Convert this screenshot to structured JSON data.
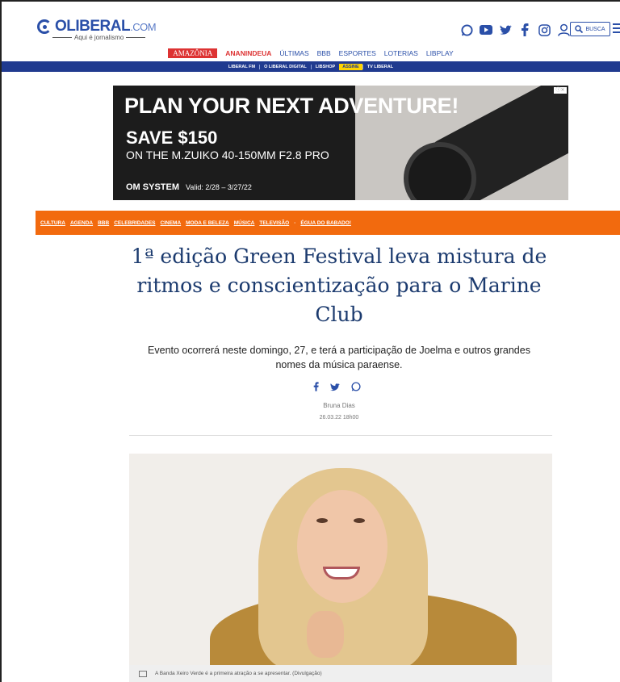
{
  "site": {
    "logo_name": "OLIBERAL",
    "logo_suffix": ".COM",
    "tagline": "Aqui é jornalismo",
    "search_label": "BUSCA",
    "social_icons": [
      "whatsapp-icon",
      "youtube-icon",
      "twitter-icon",
      "facebook-icon",
      "instagram-icon",
      "user-icon"
    ],
    "brand_color": "#2a4fa8"
  },
  "top_nav": {
    "items": [
      "AMAZÔNIA",
      "ANANINDEUA",
      "ÚLTIMAS",
      "BBB",
      "ESPORTES",
      "LOTERIAS",
      "LIBPLAY"
    ]
  },
  "sub_nav": {
    "items": [
      "LIBERAL FM",
      "O LIBERAL DIGITAL",
      "LIBSHOP",
      "ASSINE",
      "TV LIBERAL"
    ]
  },
  "ad": {
    "headline": "PLAN YOUR NEXT ADVENTURE!",
    "offer": "SAVE $150",
    "product": "ON THE M.ZUIKO 40-150MM F2.8 PRO",
    "brand": "OM SYSTEM",
    "valid": "Valid: 2/28 – 3/27/22"
  },
  "section_nav": {
    "items": [
      "CULTURA",
      "AGENDA",
      "BBB",
      "CELEBRIDADES",
      "CINEMA",
      "MODA E BELEZA",
      "MÚSICA",
      "TELEVISÃO",
      "·",
      "ÉGUA DO BABADO!"
    ],
    "color": "#f26a0e"
  },
  "article": {
    "title": "1ª edição Green Festival leva mistura de ritmos e conscientização para o Marine Club",
    "subtitle": "Evento ocorrerá neste domingo, 27, e terá a participação de Joelma e outros grandes nomes da música paraense.",
    "share_icons": [
      "facebook-icon",
      "twitter-icon",
      "whatsapp-icon"
    ],
    "author": "Bruna Dias",
    "date": "26.03.22 18h00",
    "photo_caption": "A Banda Xeiro Verde é a primeira atração a se apresentar. (Divulgação)"
  }
}
